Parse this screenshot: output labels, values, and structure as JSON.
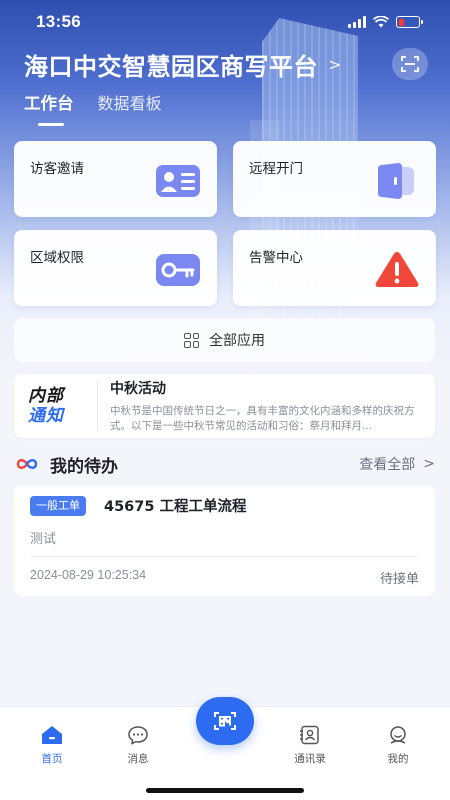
{
  "status_bar": {
    "time": "13:56"
  },
  "header": {
    "title": "海口中交智慧园区商写平台",
    "tabs": [
      {
        "label": "工作台",
        "active": true
      },
      {
        "label": "数据看板",
        "active": false
      }
    ]
  },
  "quick_actions": [
    {
      "label": "访客邀请",
      "icon": "id-card-icon"
    },
    {
      "label": "远程开门",
      "icon": "door-icon"
    },
    {
      "label": "区域权限",
      "icon": "key-icon"
    },
    {
      "label": "告警中心",
      "icon": "warning-icon"
    }
  ],
  "all_apps_label": "全部应用",
  "notice": {
    "logo_line1": "内部",
    "logo_line2": "通知",
    "title": "中秋活动",
    "text": "中秋节是中国传统节日之一，具有丰富的文化内涵和多样的庆祝方式。以下是一些中秋节常见的活动和习俗：祭月和拜月..."
  },
  "todo": {
    "title": "我的待办",
    "view_all": "查看全部",
    "items": [
      {
        "tag": "一般工单",
        "order": "45675 工程工单流程",
        "desc": "测试",
        "date": "2024-08-29 10:25:34",
        "state": "待接单"
      }
    ]
  },
  "tabbar": {
    "items": [
      {
        "label": "首页",
        "icon": "home-icon",
        "active": true
      },
      {
        "label": "消息",
        "icon": "message-icon"
      },
      {
        "label": "通讯录",
        "icon": "contacts-icon"
      },
      {
        "label": "我的",
        "icon": "profile-icon"
      }
    ],
    "center_icon": "scan-code-icon"
  },
  "colors": {
    "primary": "#2d6cf0",
    "warning": "#f0473a",
    "card_icon": "#7a86f0"
  }
}
